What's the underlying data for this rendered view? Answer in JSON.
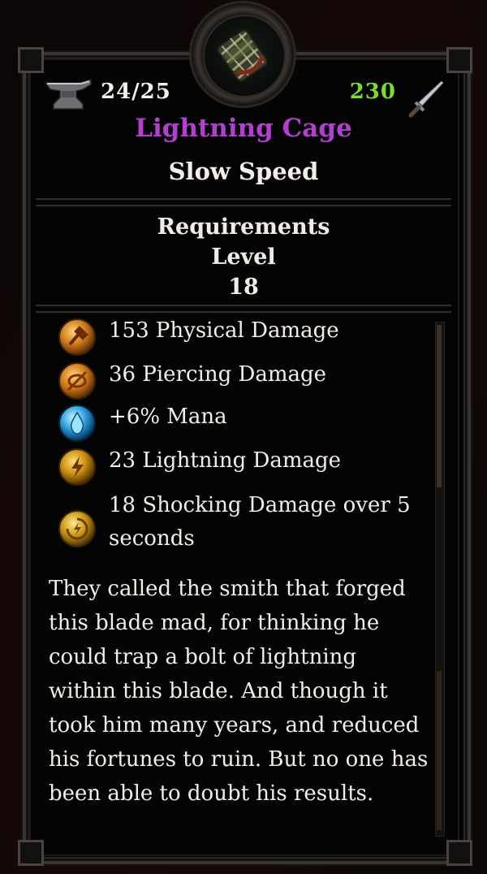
{
  "header": {
    "durability": "24/25",
    "gear_score": "230",
    "icons": [
      "anvil-icon",
      "sword-icon"
    ]
  },
  "item": {
    "name": "Lightning Cage",
    "speed": "Slow Speed",
    "name_color": "#b33fd2",
    "gear_score_color": "#7edc2c"
  },
  "requirements": {
    "title": "Requirements",
    "level_label": "Level",
    "level_value": "18"
  },
  "stats": [
    {
      "text": "153 Physical Damage",
      "icon": "physical-damage-icon"
    },
    {
      "text": "36 Piercing Damage",
      "icon": "piercing-damage-icon"
    },
    {
      "text": "+6% Mana",
      "icon": "mana-icon"
    },
    {
      "text": "23 Lightning Damage",
      "icon": "lightning-damage-icon"
    },
    {
      "text": "18 Shocking Damage over 5 seconds",
      "icon": "shocking-damage-icon"
    }
  ],
  "lore": "They called the smith that forged this blade mad, for thinking he could trap a bolt of lightning within this blade. And though it took him many years, and reduced his fortunes to ruin. But no one has been able to doubt his results."
}
